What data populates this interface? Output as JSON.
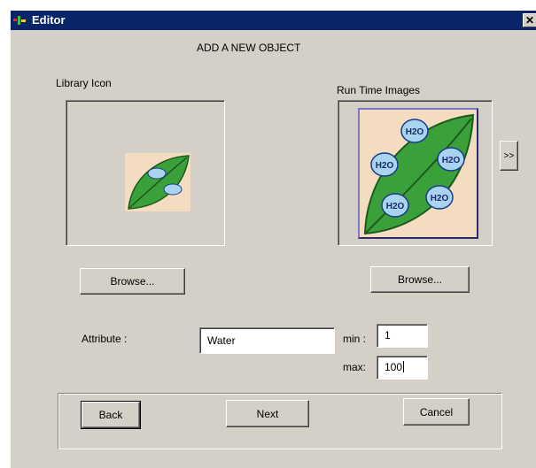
{
  "window": {
    "title": "Editor",
    "close_glyph": "✕"
  },
  "heading": "ADD A NEW OBJECT",
  "library": {
    "label": "Library Icon",
    "browse_label": "Browse..."
  },
  "runtime": {
    "label": "Run Time Images",
    "browse_label": "Browse...",
    "next_image_label": ">>",
    "molecule_label": "H2O"
  },
  "attribute": {
    "label": "Attribute :",
    "value": "Water",
    "min_label": "min :",
    "min_value": "1",
    "max_label": "max:",
    "max_value": "100"
  },
  "footer": {
    "back_label": "Back",
    "next_label": "Next",
    "cancel_label": "Cancel"
  },
  "colors": {
    "titlebar": "#0a246a",
    "face": "#d4d0c8",
    "leaf": "#3aa13a",
    "frame": "#4b4a9e"
  }
}
